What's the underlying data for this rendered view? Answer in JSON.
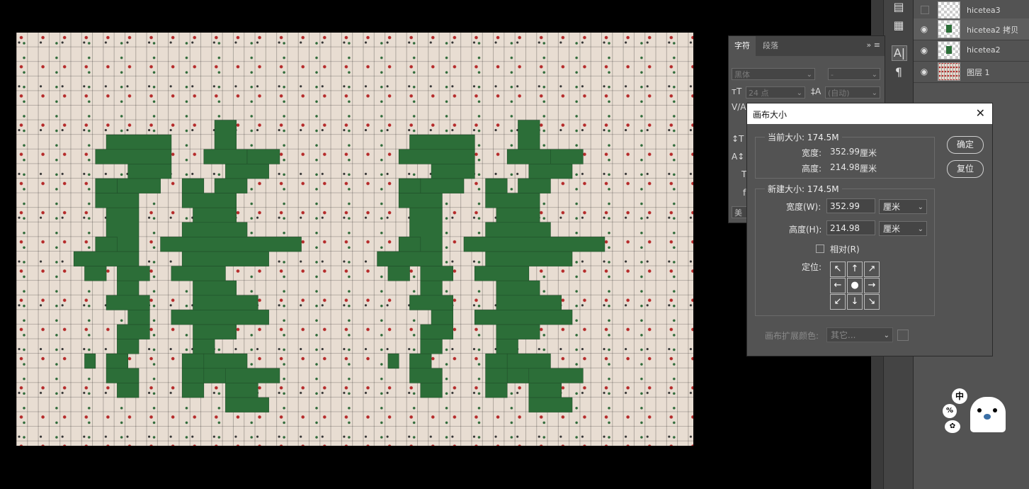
{
  "layers": [
    {
      "name": "hicetea3",
      "visible": false
    },
    {
      "name": "hicetea2 拷贝",
      "visible": true,
      "selected": true
    },
    {
      "name": "hicetea2",
      "visible": true
    },
    {
      "name": "图层 1",
      "visible": true
    }
  ],
  "char_panel": {
    "tabs": [
      "字符",
      "段落"
    ],
    "font": "黑体",
    "style": "-",
    "size": "24 点",
    "leading": "(自动)",
    "lang_partial": "美"
  },
  "dialog": {
    "title": "画布大小",
    "current": {
      "label": "当前大小: 174.5M",
      "width_label": "宽度:",
      "width_value": "352.99",
      "width_unit": "厘米",
      "height_label": "高度:",
      "height_value": "214.98",
      "height_unit": "厘米"
    },
    "new": {
      "label": "新建大小: 174.5M",
      "width_label": "宽度(W):",
      "width_value": "352.99",
      "width_unit": "厘米",
      "height_label": "高度(H):",
      "height_value": "214.98",
      "height_unit": "厘米",
      "relative_label": "相对(R)",
      "relative_checked": false,
      "anchor_label": "定位:"
    },
    "ok": "确定",
    "reset": "复位",
    "ext_color_label": "画布扩展颜色:",
    "ext_color_value": "其它..."
  },
  "sticker": {
    "text": "中"
  },
  "icons": {
    "close": "close-icon",
    "eye": "eye-icon",
    "panel_menu": "menu-icon"
  }
}
